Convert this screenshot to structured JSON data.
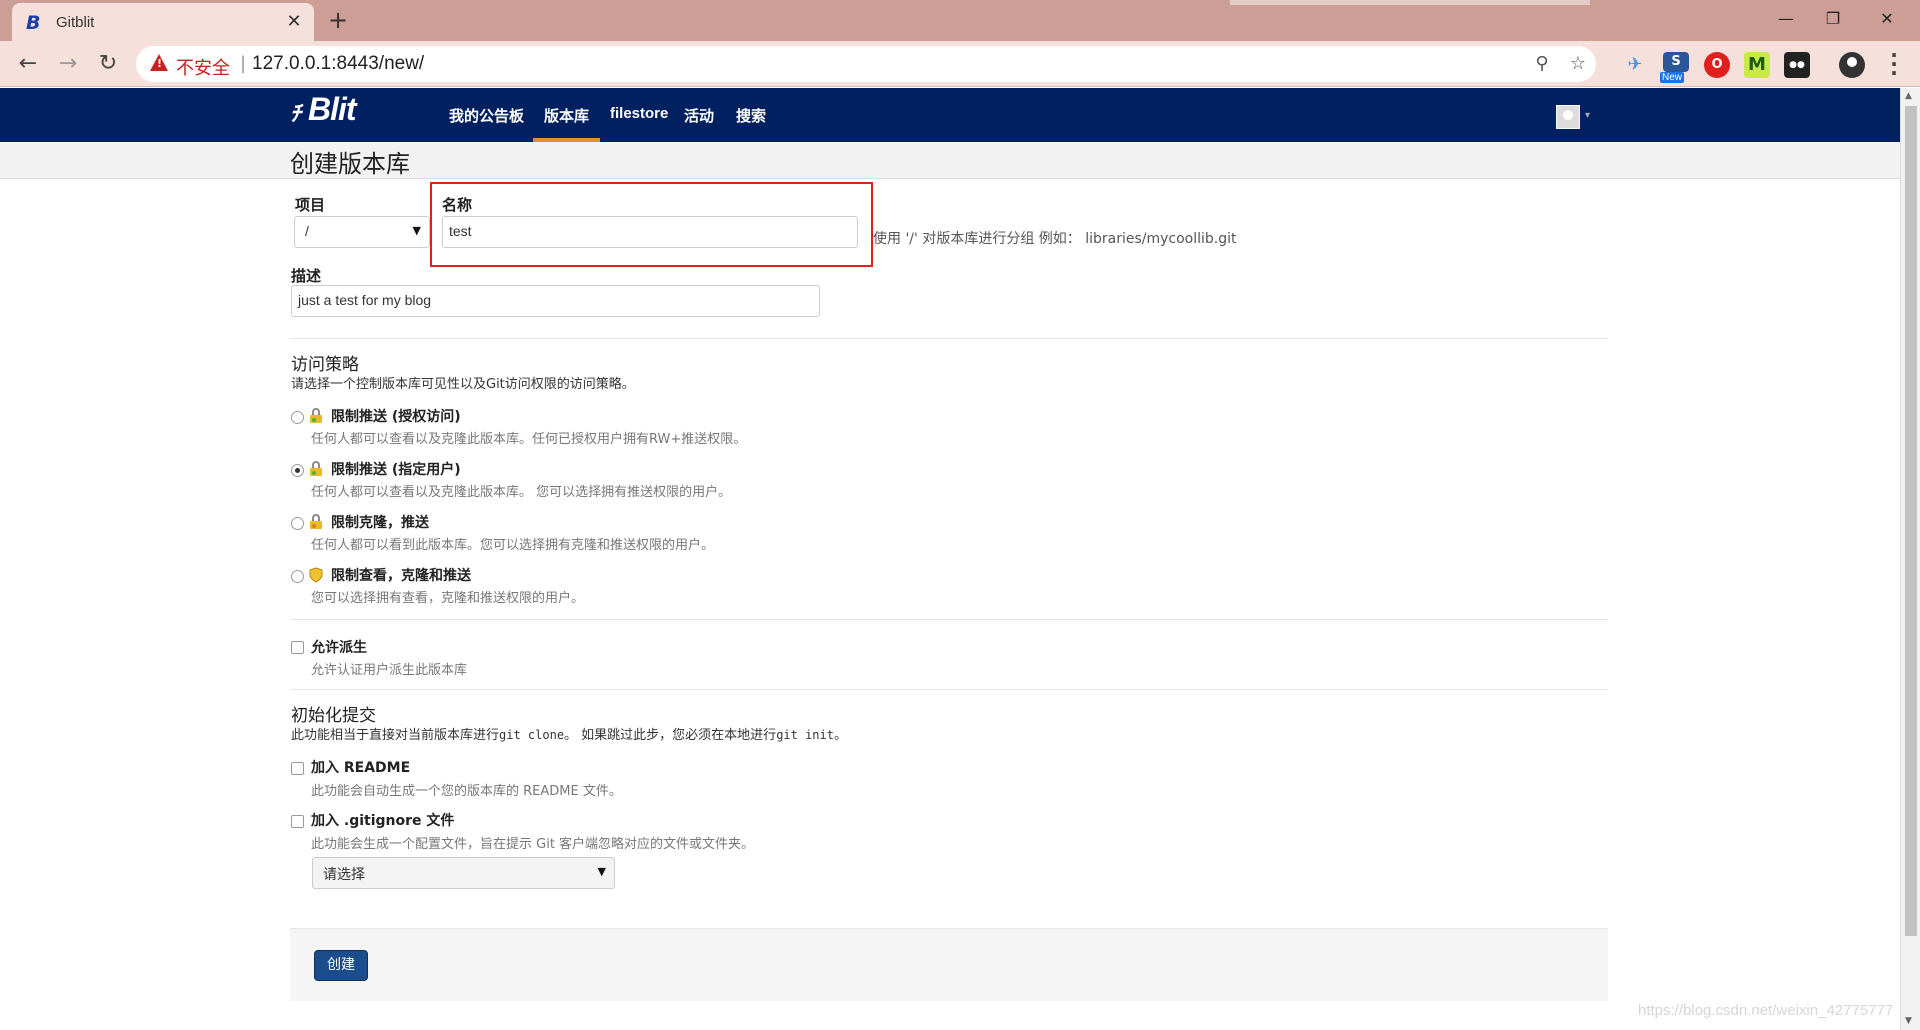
{
  "browser": {
    "tab_title": "Gitblit",
    "tab_favicon": "B",
    "tab_close": "✕",
    "new_tab": "+",
    "window_controls": [
      "—",
      "❐",
      "✕"
    ],
    "nav": {
      "back": "←",
      "forward": "→",
      "reload": "↻"
    },
    "security_label": "不安全",
    "separator": "|",
    "url": "127.0.0.1:8443/new/",
    "zoom_icon": "⚲",
    "star_icon": "☆",
    "extensions": [
      {
        "name": "bookmark-extension-icon",
        "glyph": "✈",
        "color": "#4a90e2"
      },
      {
        "name": "new-extension-icon",
        "glyph": "S",
        "color": "#2b5797"
      },
      {
        "name": "ublock-extension-icon",
        "glyph": "O",
        "color": "#e0201e"
      },
      {
        "name": "m-extension-icon",
        "glyph": "M",
        "color": "#3a7d1e"
      },
      {
        "name": "sunglasses-extension-icon",
        "glyph": "●●",
        "color": "#222222"
      }
    ],
    "new_badge": "New"
  },
  "gitblit": {
    "logo_mark": "ﾁ",
    "logo_text": "Blit",
    "nav_items": [
      "我的公告板",
      "版本库",
      "filestore",
      "活动",
      "搜索"
    ],
    "active_nav_index": 1,
    "avatar_caret": "▾"
  },
  "page": {
    "title": "创建版本库"
  },
  "form": {
    "project_label": "项目",
    "project_value": "/",
    "name_label": "名称",
    "name_value": "test",
    "name_hint": "使用 '/' 对版本库进行分组 例如： libraries/mycoollib.git",
    "description_label": "描述",
    "description_value": "just a test for my blog",
    "access_title": "访问策略",
    "access_desc": "请选择一个控制版本库可见性以及Git访问权限的访问策略。",
    "access_options": [
      {
        "title": "限制推送 (授权访问)",
        "desc": "任何人都可以查看以及克隆此版本库。任何已授权用户拥有RW+推送权限。",
        "checked": false,
        "icon_color": "#e8b923"
      },
      {
        "title": "限制推送 (指定用户)",
        "desc": "任何人都可以查看以及克隆此版本库。 您可以选择拥有推送权限的用户。",
        "checked": true,
        "icon_color": "#e8b923"
      },
      {
        "title": "限制克隆，推送",
        "desc": "任何人都可以看到此版本库。您可以选择拥有克隆和推送权限的用户。",
        "checked": false,
        "icon_color": "#e8b923"
      },
      {
        "title": "限制查看，克隆和推送",
        "desc": "您可以选择拥有查看，克隆和推送权限的用户。",
        "checked": false,
        "icon_color": "#f2c12e"
      }
    ],
    "allow_fork_title": "允许派生",
    "allow_fork_desc": "允许认证用户派生此版本库",
    "init_title": "初始化提交",
    "init_desc_pre": "此功能相当于直接对当前版本库进行",
    "init_desc_cmd1": "git clone",
    "init_desc_mid": "。 如果跳过此步，您必须在本地进行",
    "init_desc_cmd2": "git init",
    "init_desc_post": "。",
    "readme_title": "加入 README",
    "readme_desc": "此功能会自动生成一个您的版本库的 README 文件。",
    "gitignore_title": "加入 .gitignore 文件",
    "gitignore_desc": "此功能会生成一个配置文件，旨在提示 Git 客户端忽略对应的文件或文件夹。",
    "gitignore_select": "请选择",
    "create_button": "创建"
  },
  "watermark": "https://blog.csdn.net/weixin_42775777"
}
